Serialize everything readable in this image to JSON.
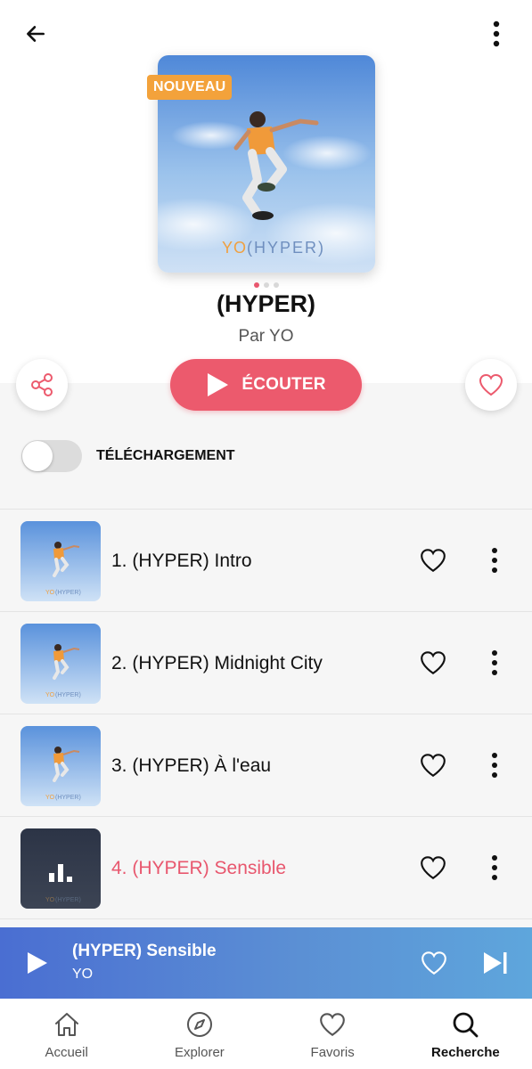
{
  "header": {
    "back_icon": "arrow-left-icon",
    "more_icon": "more-vertical-icon"
  },
  "album": {
    "badge": "NOUVEAU",
    "cover_text": "YO(HYPER)",
    "title": "(HYPER)",
    "artist": "Par YO",
    "carousel_pages": 3,
    "carousel_active": 0
  },
  "actions": {
    "play_label": "ÉCOUTER",
    "download_label": "TÉLÉCHARGEMENT",
    "download_enabled": false
  },
  "tracks": [
    {
      "title": "1. (HYPER) Intro",
      "playing": false
    },
    {
      "title": "2. (HYPER) Midnight City",
      "playing": false
    },
    {
      "title": "3. (HYPER) À l'eau",
      "playing": false
    },
    {
      "title": "4. (HYPER) Sensible",
      "playing": true
    }
  ],
  "mini_player": {
    "title": "(HYPER) Sensible",
    "artist": "YO"
  },
  "nav": [
    {
      "label": "Accueil",
      "icon": "home-icon",
      "active": false
    },
    {
      "label": "Explorer",
      "icon": "compass-icon",
      "active": false
    },
    {
      "label": "Favoris",
      "icon": "heart-icon",
      "active": false
    },
    {
      "label": "Recherche",
      "icon": "search-icon",
      "active": true
    }
  ],
  "colors": {
    "accent": "#ec5a6d",
    "badge": "#f3a23b",
    "player_gradient_start": "#4a6ed2",
    "player_gradient_end": "#5ea6dc"
  }
}
